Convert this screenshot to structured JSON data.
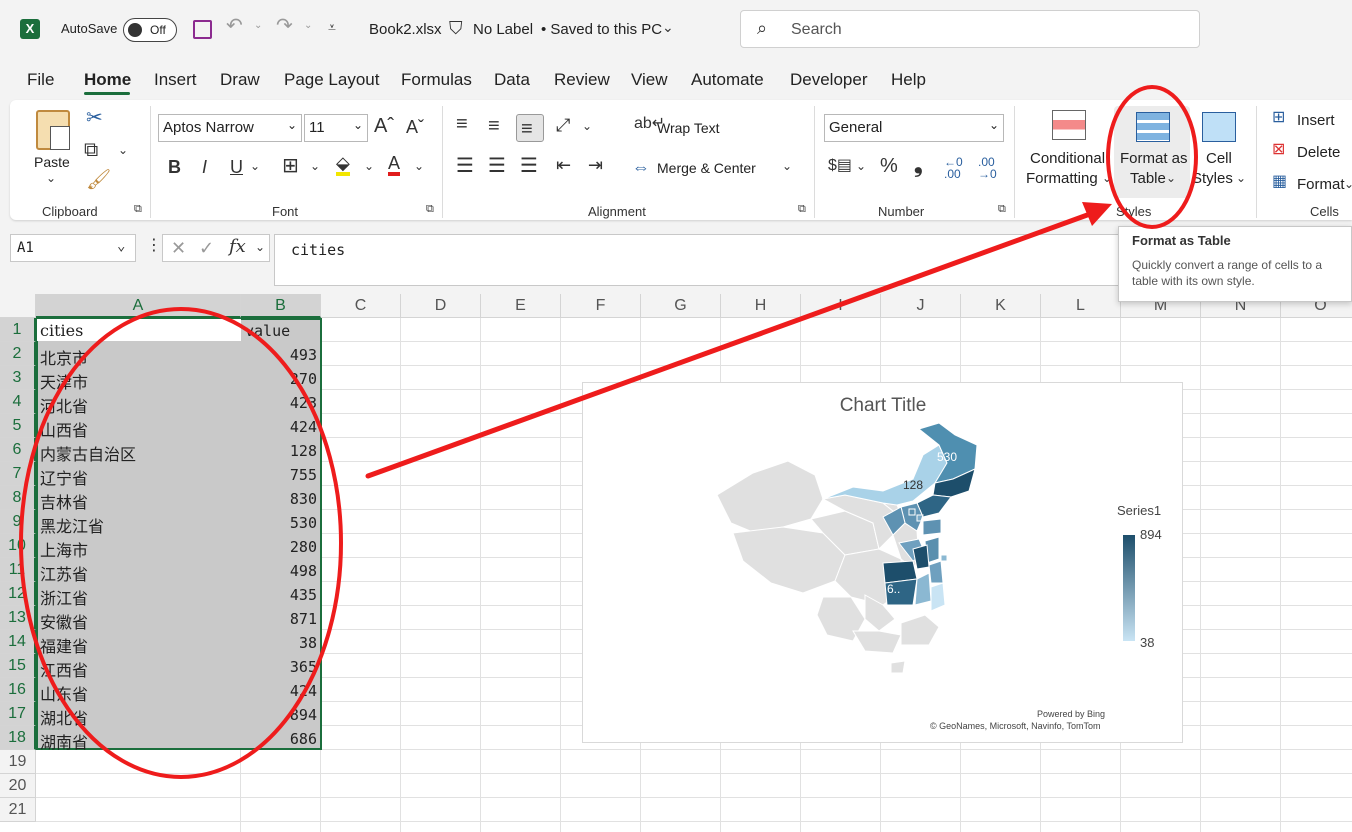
{
  "titlebar": {
    "autosave_label": "AutoSave",
    "autosave_state": "Off",
    "filename": "Book2.xlsx",
    "label_status": "No Label",
    "save_status": "• Saved to this PC",
    "search_placeholder": "Search"
  },
  "menu": [
    "File",
    "Home",
    "Insert",
    "Draw",
    "Page Layout",
    "Formulas",
    "Data",
    "Review",
    "View",
    "Automate",
    "Developer",
    "Help"
  ],
  "ribbon": {
    "clipboard": {
      "paste": "Paste",
      "label": "Clipboard"
    },
    "font": {
      "name": "Aptos Narrow",
      "size": "11",
      "label": "Font"
    },
    "alignment": {
      "wrap_text": "Wrap Text",
      "merge_center": "Merge & Center",
      "label": "Alignment"
    },
    "number": {
      "format": "General",
      "label": "Number"
    },
    "styles": {
      "conditional_1": "Conditional",
      "conditional_2": "Formatting",
      "format_table_1": "Format as",
      "format_table_2": "Table",
      "cell_styles_1": "Cell",
      "cell_styles_2": "Styles",
      "label": "Styles"
    },
    "cells": {
      "insert": "Insert",
      "delete": "Delete",
      "format": "Format",
      "label": "Cells"
    }
  },
  "tooltip": {
    "title": "Format as Table",
    "body": "Quickly convert a range of cells to a table with its own style."
  },
  "formula_bar": {
    "name_box": "A1",
    "fx": "fx",
    "content": "cities"
  },
  "columns": [
    "A",
    "B",
    "C",
    "D",
    "E",
    "F",
    "G",
    "H",
    "I",
    "J",
    "K",
    "L",
    "M",
    "N",
    "O"
  ],
  "rows": [
    "1",
    "2",
    "3",
    "4",
    "5",
    "6",
    "7",
    "8",
    "9",
    "10",
    "11",
    "12",
    "13",
    "14",
    "15",
    "16",
    "17",
    "18",
    "19",
    "20",
    "21"
  ],
  "sheet": {
    "header": {
      "a": "cities",
      "b": "value"
    },
    "data": [
      {
        "a": "北京市",
        "b": "493"
      },
      {
        "a": "天津市",
        "b": "270"
      },
      {
        "a": "河北省",
        "b": "423"
      },
      {
        "a": "山西省",
        "b": "424"
      },
      {
        "a": "内蒙古自治区",
        "b": "128"
      },
      {
        "a": "辽宁省",
        "b": "755"
      },
      {
        "a": "吉林省",
        "b": "830"
      },
      {
        "a": "黑龙江省",
        "b": "530"
      },
      {
        "a": "上海市",
        "b": "280"
      },
      {
        "a": "江苏省",
        "b": "498"
      },
      {
        "a": "浙江省",
        "b": "435"
      },
      {
        "a": "安徽省",
        "b": "871"
      },
      {
        "a": "福建省",
        "b": "38"
      },
      {
        "a": "江西省",
        "b": "365"
      },
      {
        "a": "山东省",
        "b": "424"
      },
      {
        "a": "湖北省",
        "b": "894"
      },
      {
        "a": "湖南省",
        "b": "686"
      }
    ]
  },
  "chart": {
    "title": "Chart Title",
    "label_heilongjiang": "530",
    "label_inner_mongolia": "128",
    "label_hubei": "6..",
    "legend_title": "Series1",
    "legend_max": "894",
    "legend_min": "38",
    "credit_1": "Powered by Bing",
    "credit_2": "© GeoNames, Microsoft, Navinfo, TomTom"
  },
  "colors": {
    "excel_green": "#1b6e3c",
    "annotation_red": "#ee1c1c",
    "map_dark": "#1d4e6b",
    "map_light": "#c9e4f4"
  }
}
